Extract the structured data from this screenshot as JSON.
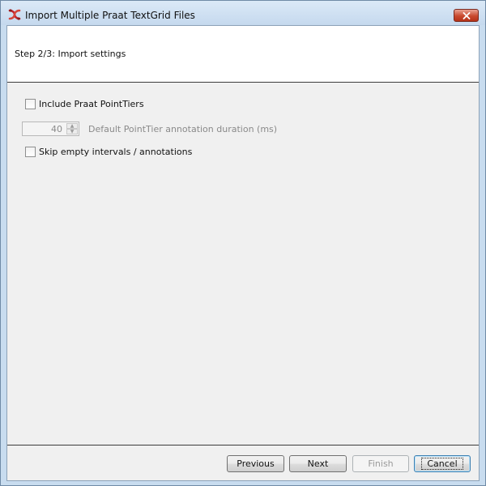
{
  "window": {
    "title": "Import Multiple Praat TextGrid Files"
  },
  "wizard": {
    "step_title": "Step 2/3: Import settings"
  },
  "options": {
    "include_point_tiers": {
      "label": "Include Praat PointTiers",
      "checked": false
    },
    "duration": {
      "value": "40",
      "label": "Default PointTier annotation duration (ms)",
      "enabled": false
    },
    "skip_empty": {
      "label": "Skip empty intervals / annotations",
      "checked": false
    }
  },
  "buttons": {
    "previous": "Previous",
    "next": "Next",
    "finish": "Finish",
    "cancel": "Cancel"
  },
  "icons": {
    "app": "elan-app-icon",
    "close": "close-icon",
    "spin_up": "chevron-up-icon",
    "spin_down": "chevron-down-icon"
  },
  "colors": {
    "close_button": "#c9492f",
    "title_bar": "#c8dcef",
    "disabled_text": "#8a8a8a"
  }
}
